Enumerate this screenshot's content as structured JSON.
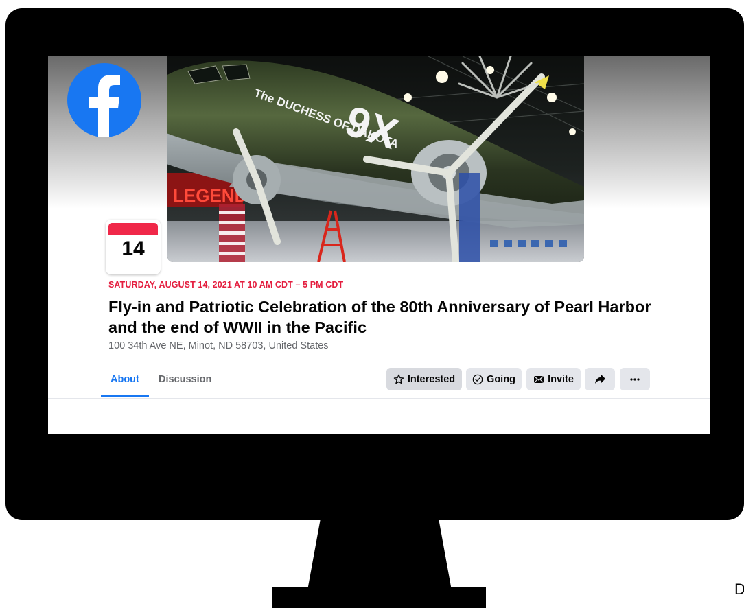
{
  "screen": {
    "date_badge_day": "14",
    "event": {
      "date_line": "SATURDAY, AUGUST 14, 2021 AT 10 AM CDT – 5 PM CDT",
      "title": "Fly-in and Patriotic Celebration of the 80th Anniversary of Pearl Harbor and the end of WWII in the Pacific",
      "location": "100 34th Ave NE, Minot, ND 58703, United States"
    },
    "tabs": [
      {
        "label": "About",
        "active": true
      },
      {
        "label": "Discussion",
        "active": false
      }
    ],
    "actions": {
      "interested": "Interested",
      "going": "Going",
      "invite": "Invite"
    },
    "cover_photo": {
      "fuselage_text": "The DUCHESS OF DAKOTA",
      "tail_code": "9X",
      "banner_text": "LEGENDS"
    }
  },
  "outside_text": "D",
  "colors": {
    "facebook_blue": "#1877f2",
    "event_red": "#e41e3f",
    "button_gray": "#e4e6eb",
    "monitor": "#000000"
  },
  "icons": [
    "facebook-logo-icon",
    "star-icon",
    "check-circle-icon",
    "envelope-icon",
    "share-arrow-icon",
    "more-dots-icon"
  ]
}
